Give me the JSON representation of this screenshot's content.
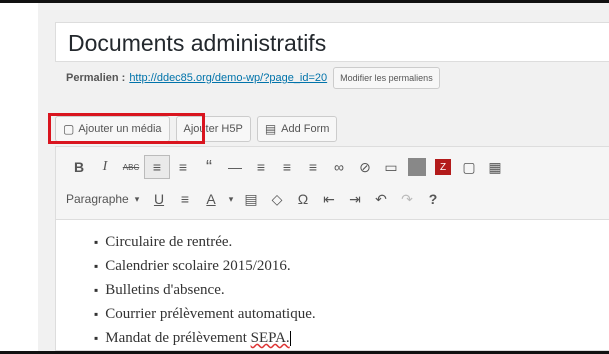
{
  "post": {
    "title": "Documents administratifs",
    "permalink_label": "Permalien :",
    "permalink_url": "http://ddec85.org/demo-wp/?page_id=20",
    "edit_permalink_label": "Modifier les permaliens"
  },
  "media_buttons": {
    "add_media_icon": "media-icon",
    "add_media": "Ajouter un média",
    "add_h5p": "Ajouter H5P",
    "add_form_icon": "form-icon",
    "add_form": "Add Form"
  },
  "toolbar": {
    "row1": [
      "B",
      "I",
      "ABC",
      "≡",
      "≡",
      "“",
      "—",
      "≡",
      "≡",
      "≡",
      "∞",
      "⊘",
      "▭",
      "■",
      "Z",
      "▢",
      "▦"
    ],
    "format_value": "Paragraphe",
    "row2": [
      "U",
      "≡",
      "A",
      "▾",
      "▤",
      "◇",
      "Ω",
      "⇤",
      "⇥",
      "↶",
      "↷",
      "?"
    ]
  },
  "content": {
    "items": [
      "Circulaire de rentrée.",
      "Calendrier scolaire 2015/2016.",
      "Bulletins d'absence.",
      "Courrier prélèvement automatique.",
      "Mandat de prélèvement "
    ],
    "last_item_suffix": "SEPA."
  },
  "colors": {
    "highlight": "#d9141e",
    "link": "#0073aa"
  }
}
